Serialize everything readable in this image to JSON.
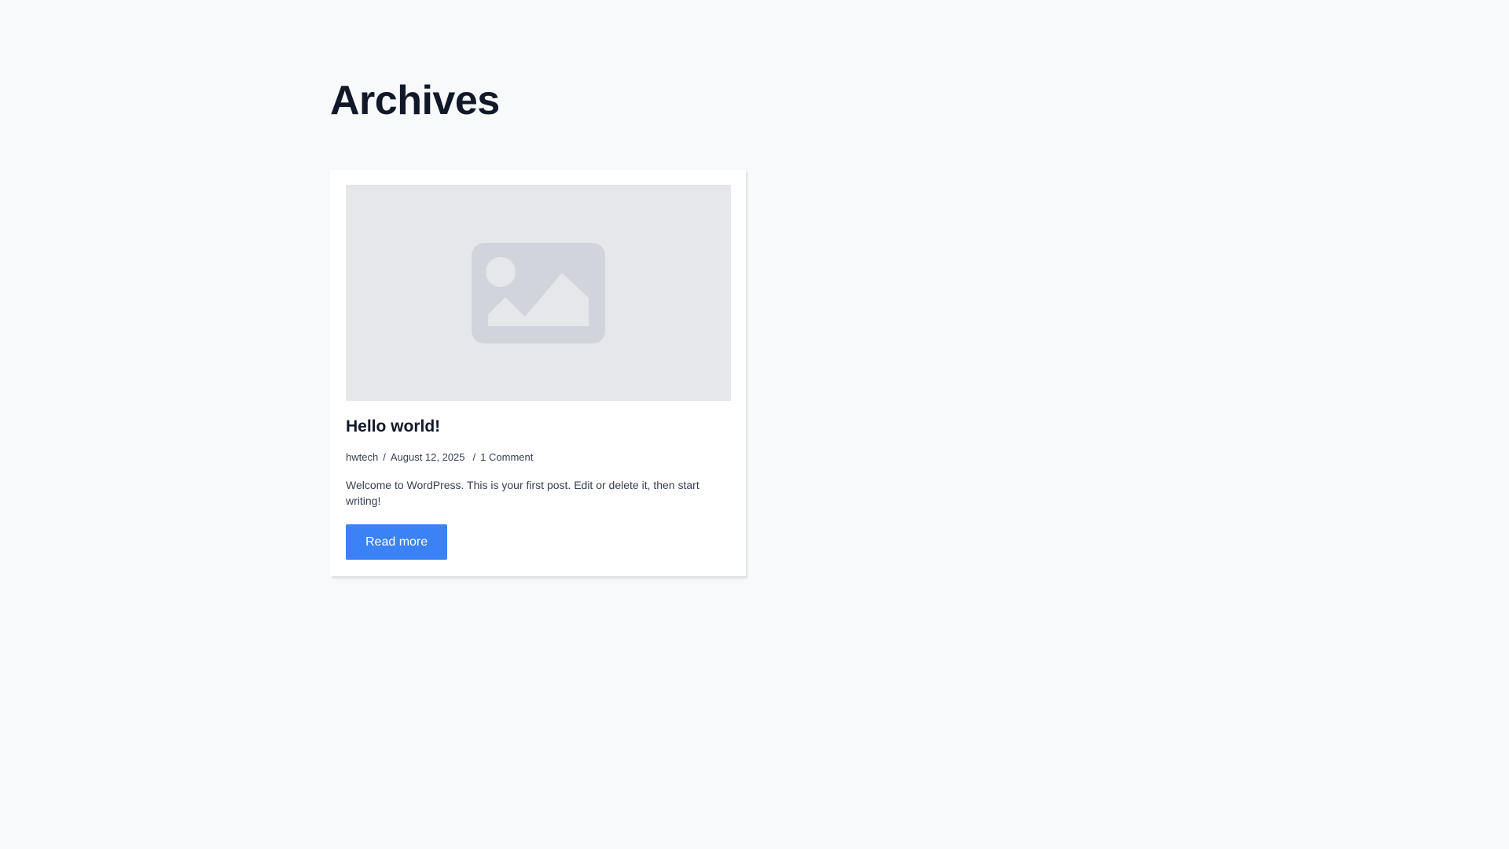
{
  "archive": {
    "title": "Archives"
  },
  "post": {
    "title": "Hello world!",
    "author": "hwtech",
    "separator": "/",
    "date": "August 12, 2025",
    "comments": "1 Comment",
    "excerpt": "Welcome to WordPress. This is your first post. Edit or delete it, then start writing!",
    "read_more_label": "Read more",
    "thumbnail_icon": "image-placeholder-icon"
  },
  "colors": {
    "background": "#f8f9fb",
    "card": "#ffffff",
    "thumbnail_bg": "#e5e7eb",
    "icon": "#d1d5db",
    "accent": "#3b82f6",
    "title": "#111827"
  }
}
